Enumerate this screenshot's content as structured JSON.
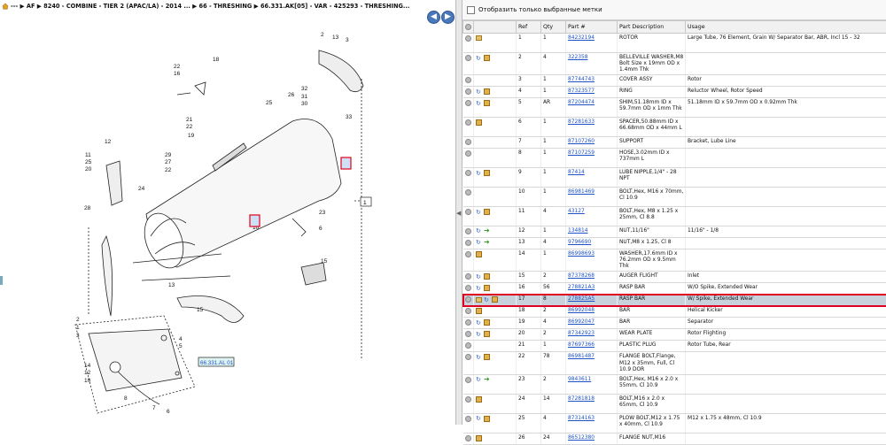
{
  "breadcrumb": {
    "home_icon": "home-icon",
    "text": "--- ▶ AF ▶ 8240 - COMBINE - TIER 2 (APAC/LA) - 2014 ... ▶ 66 - THRESHING ▶ 66.331.AK[05] - VAR - 425293 - THRESHING..."
  },
  "nav": {
    "back_icon": "arrow-left-icon",
    "forward_icon": "arrow-right-icon"
  },
  "diagram": {
    "ref_labels": [
      "2",
      "13",
      "3",
      "18",
      "22",
      "16",
      "25",
      "26",
      "32",
      "31",
      "30",
      "33",
      "21",
      "22",
      "19",
      "12",
      "11",
      "25",
      "20",
      "29",
      "27",
      "22",
      "24",
      "28",
      "23",
      "6",
      "10",
      "15",
      "13",
      "15",
      "18",
      "22",
      "22",
      "16",
      "9",
      "17",
      "19",
      "7",
      "14",
      "26",
      "2",
      "1",
      "3",
      "4",
      "5",
      "14",
      "12",
      "10",
      "8",
      "7",
      "6",
      "1"
    ],
    "group_code": "66.331.AL 01",
    "group_ref": "1"
  },
  "filter": {
    "label": "Отобразить только выбранные метки",
    "checked": false
  },
  "table": {
    "headers": [
      "",
      "",
      "Ref",
      "Qty",
      "Part #",
      "Part Description",
      "Usage"
    ],
    "rows": [
      {
        "icons": [
          "circ",
          "rsq"
        ],
        "ref": "1",
        "qty": "1",
        "part": "84232194",
        "desc": "ROTOR",
        "usage": "Large Tube, 76 Element, Grain W/ Separator Bar, ABR, Incl 15 - 32"
      },
      {
        "icons": [
          "circ",
          "blu",
          "box"
        ],
        "ref": "2",
        "qty": "4",
        "part": "322358",
        "desc": "BELLEVILLE WASHER,M8 Bolt Size x 19mm OD x 1.4mm Thk",
        "usage": ""
      },
      {
        "icons": [
          "circ"
        ],
        "ref": "3",
        "qty": "1",
        "part": "87744743",
        "desc": "COVER ASSY",
        "usage": "Rotor"
      },
      {
        "icons": [
          "circ",
          "blu",
          "box"
        ],
        "ref": "4",
        "qty": "1",
        "part": "87323577",
        "desc": "RING",
        "usage": "Reluctor Wheel, Rotor Speed"
      },
      {
        "icons": [
          "circ",
          "blu",
          "box"
        ],
        "ref": "5",
        "qty": "AR",
        "part": "87204474",
        "desc": "SHIM,51.18mm ID x 59.7mm OD x 1mm Thk",
        "usage": "51.18mm ID x 59.7mm OD x 0.92mm Thk"
      },
      {
        "icons": [
          "circ",
          "box"
        ],
        "ref": "6",
        "qty": "1",
        "part": "87281633",
        "desc": "SPACER,50.88mm ID x 66.68mm OD x 44mm L",
        "usage": ""
      },
      {
        "icons": [
          "circ"
        ],
        "ref": "7",
        "qty": "1",
        "part": "87107260",
        "desc": "SUPPORT",
        "usage": "Bracket, Lube Line"
      },
      {
        "icons": [
          "circ"
        ],
        "ref": "8",
        "qty": "1",
        "part": "87107259",
        "desc": "HOSE,3.02mm ID x 737mm L",
        "usage": ""
      },
      {
        "icons": [
          "circ",
          "blu",
          "box"
        ],
        "ref": "9",
        "qty": "1",
        "part": "87414",
        "desc": "LUBE NIPPLE,1/4\" - 28 NPT",
        "usage": ""
      },
      {
        "icons": [
          "circ"
        ],
        "ref": "10",
        "qty": "1",
        "part": "86981469",
        "desc": "BOLT,Hex, M16 x 70mm, Cl 10.9",
        "usage": ""
      },
      {
        "icons": [
          "circ",
          "blu",
          "box"
        ],
        "ref": "11",
        "qty": "4",
        "part": "43127",
        "desc": "BOLT,Hex, M8 x 1.25 x 25mm, Cl 8.8",
        "usage": ""
      },
      {
        "icons": [
          "circ",
          "blu",
          "grn"
        ],
        "ref": "12",
        "qty": "1",
        "part": "134814",
        "desc": "NUT,11/16\"",
        "usage": "11/16\" - 1/8"
      },
      {
        "icons": [
          "circ",
          "blu",
          "grn"
        ],
        "ref": "13",
        "qty": "4",
        "part": "9796690",
        "desc": "NUT,M8 x 1.25, Cl 8",
        "usage": ""
      },
      {
        "icons": [
          "circ",
          "box"
        ],
        "ref": "14",
        "qty": "1",
        "part": "86998693",
        "desc": "WASHER,17.6mm ID x 76.2mm OD x 9.5mm Thk",
        "usage": ""
      },
      {
        "icons": [
          "circ",
          "blu",
          "box"
        ],
        "ref": "15",
        "qty": "2",
        "part": "87378268",
        "desc": "AUGER FLIGHT",
        "usage": "Inlet"
      },
      {
        "icons": [
          "circ",
          "blu",
          "box"
        ],
        "ref": "16",
        "qty": "56",
        "part": "278821A3",
        "desc": "RASP BAR",
        "usage": "W/O Spike, Extended Wear"
      },
      {
        "icons": [
          "circ",
          "rsq",
          "blu",
          "box"
        ],
        "ref": "17",
        "qty": "8",
        "part": "278825A5",
        "desc": "RASP BAR",
        "usage": "W/ Spike, Extended Wear",
        "selected": true
      },
      {
        "icons": [
          "circ",
          "box"
        ],
        "ref": "18",
        "qty": "2",
        "part": "86992048",
        "desc": "BAR",
        "usage": "Helical Kicker"
      },
      {
        "icons": [
          "circ",
          "blu",
          "box"
        ],
        "ref": "19",
        "qty": "4",
        "part": "86992047",
        "desc": "BAR",
        "usage": "Separator"
      },
      {
        "icons": [
          "circ",
          "blu",
          "box"
        ],
        "ref": "20",
        "qty": "2",
        "part": "87342923",
        "desc": "WEAR PLATE",
        "usage": "Rotor Flighting"
      },
      {
        "icons": [
          "circ"
        ],
        "ref": "21",
        "qty": "1",
        "part": "87697366",
        "desc": "PLASTIC PLUG",
        "usage": "Rotor Tube, Rear"
      },
      {
        "icons": [
          "circ",
          "blu",
          "box"
        ],
        "ref": "22",
        "qty": "78",
        "part": "86981487",
        "desc": "FLANGE BOLT,Flange, M12 x 35mm, Full, Cl 10.9 DOR",
        "usage": ""
      },
      {
        "icons": [
          "circ",
          "blu",
          "grn"
        ],
        "ref": "23",
        "qty": "2",
        "part": "9843611",
        "desc": "BOLT,Hex, M16 x 2.0 x 55mm, Cl 10.9",
        "usage": ""
      },
      {
        "icons": [
          "circ",
          "box"
        ],
        "ref": "24",
        "qty": "14",
        "part": "87281818",
        "desc": "BOLT,M16 x 2.0 x 65mm, Cl 10.9",
        "usage": ""
      },
      {
        "icons": [
          "circ",
          "blu",
          "box"
        ],
        "ref": "25",
        "qty": "4",
        "part": "87314163",
        "desc": "PLOW BOLT,M12 x 1.75 x 40mm, Cl 10.9",
        "usage": "M12 x 1.75 x 48mm, Cl 10.9"
      },
      {
        "icons": [
          "circ",
          "box"
        ],
        "ref": "26",
        "qty": "24",
        "part": "86512380",
        "desc": "FLANGE NUT,M16",
        "usage": ""
      }
    ]
  }
}
